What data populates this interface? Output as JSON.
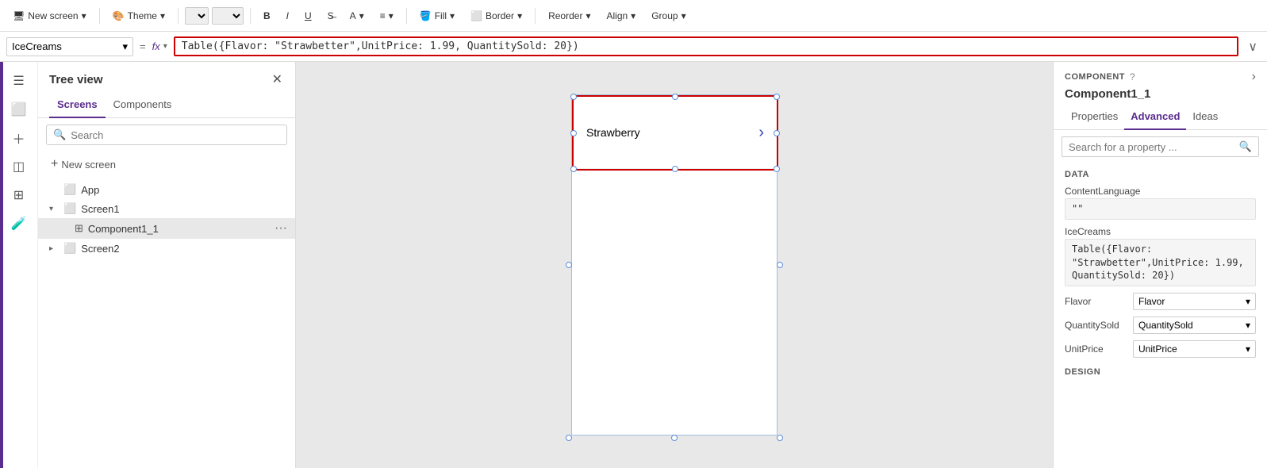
{
  "toolbar": {
    "new_screen": "New screen",
    "theme": "Theme",
    "bold": "B",
    "italic": "I",
    "underline": "U",
    "align_text": "A̲",
    "fill": "Fill",
    "border": "Border",
    "reorder": "Reorder",
    "align": "Align",
    "group": "Group"
  },
  "formula_bar": {
    "name": "IceCreams",
    "fx": "fx",
    "formula": "Table({Flavor: \"Strawbetter\",UnitPrice: 1.99, QuantitySold: 20})",
    "formula_display": "Table({Flavor: \"Strawbetter\",UnitPrice: 1.99, QuantitySold: 20})"
  },
  "tree_view": {
    "title": "Tree view",
    "search_placeholder": "Search",
    "tabs": [
      "Screens",
      "Components"
    ],
    "active_tab": "Screens",
    "items": [
      {
        "label": "App",
        "icon": "☐",
        "indent": 0,
        "expand": ""
      },
      {
        "label": "Screen1",
        "icon": "☐",
        "indent": 0,
        "expand": "▾"
      },
      {
        "label": "Component1_1",
        "icon": "⊞",
        "indent": 1,
        "expand": "",
        "selected": true
      },
      {
        "label": "Screen2",
        "icon": "☐",
        "indent": 0,
        "expand": "▸"
      }
    ]
  },
  "canvas": {
    "list_item_text": "Strawberry",
    "chevron": "›"
  },
  "right_panel": {
    "component_section": "COMPONENT",
    "component_name": "Component1_1",
    "tabs": [
      "Properties",
      "Advanced",
      "Ideas"
    ],
    "active_tab": "Advanced",
    "search_placeholder": "Search for a property ...",
    "sections": {
      "data": {
        "label": "DATA",
        "content_language_label": "ContentLanguage",
        "content_language_value": "\"\"",
        "ice_creams_label": "IceCreams",
        "ice_creams_value": "Table({Flavor:\n\"Strawbetter\",UnitPrice: 1.99,\nQuantitySold: 20})",
        "flavor_label": "Flavor",
        "flavor_value": "Flavor",
        "quantity_sold_label": "QuantitySold",
        "quantity_sold_value": "QuantitySold",
        "unit_price_label": "UnitPrice",
        "unit_price_value": "UnitPrice"
      },
      "design": {
        "label": "DESIGN"
      }
    }
  }
}
